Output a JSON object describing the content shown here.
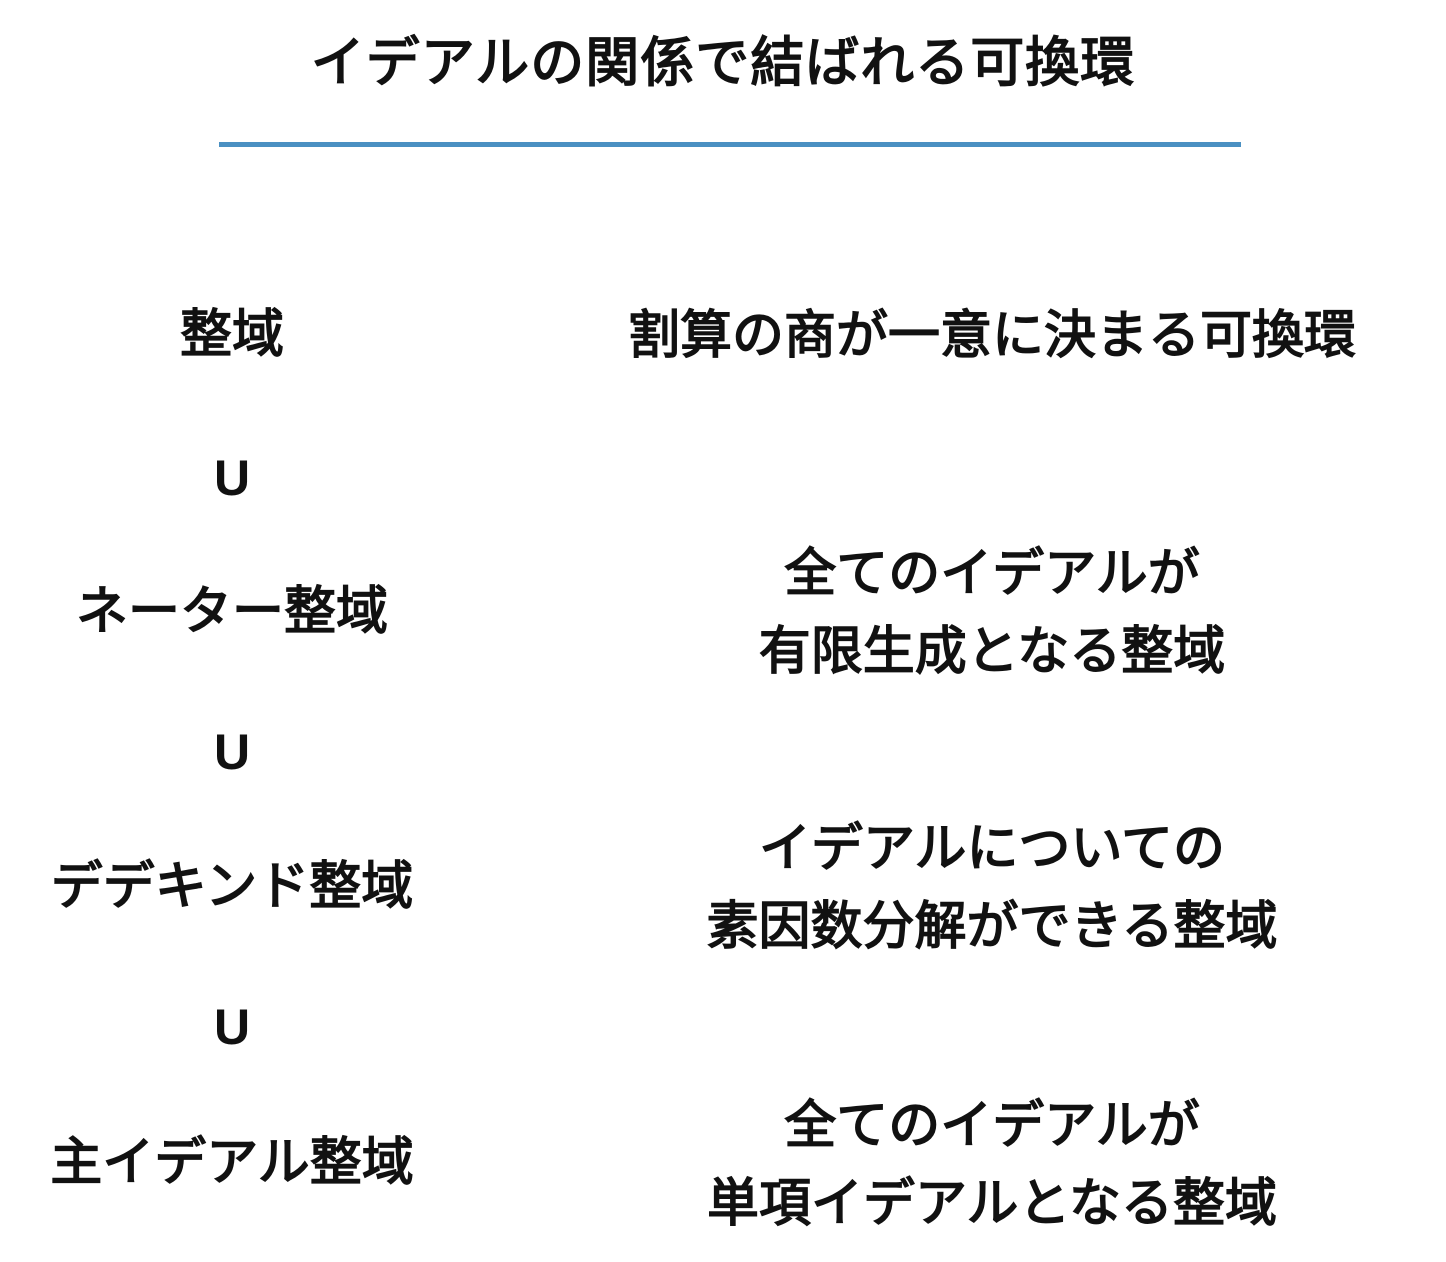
{
  "title": "イデアルの関係で結ばれる可換環",
  "colors": {
    "accent_rule": "#4a90c2",
    "text": "#111111"
  },
  "subset_symbol": "U",
  "rows": [
    {
      "term": "整域",
      "description": [
        "割算の商が一意に決まる可換環"
      ]
    },
    {
      "term": "ネーター整域",
      "description": [
        "全てのイデアルが",
        "有限生成となる整域"
      ]
    },
    {
      "term": "デデキンド整域",
      "description": [
        "イデアルについての",
        "素因数分解ができる整域"
      ]
    },
    {
      "term": "主イデアル整域",
      "description": [
        "全てのイデアルが",
        "単項イデアルとなる整域"
      ]
    }
  ]
}
